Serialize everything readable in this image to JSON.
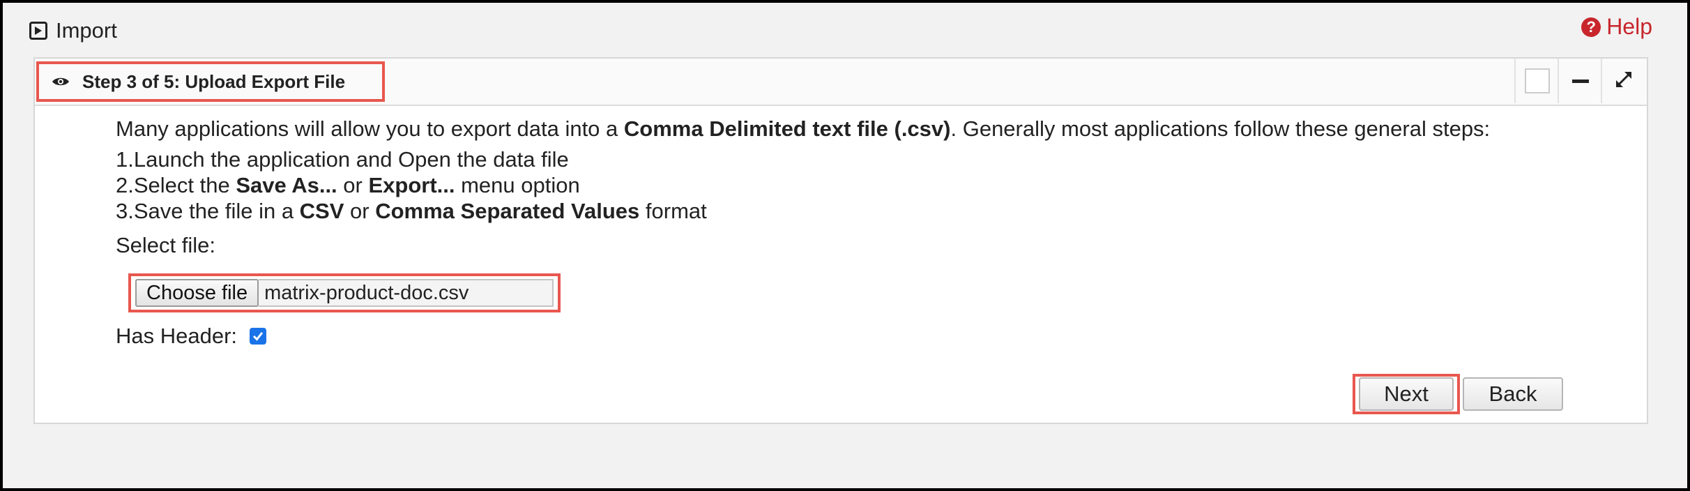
{
  "header": {
    "title": "Import",
    "help_label": "Help"
  },
  "panel": {
    "step_title": "Step 3 of 5: Upload Export File"
  },
  "instructions": {
    "intro_prefix": "Many applications will allow you to export data into a ",
    "intro_bold": "Comma Delimited text file (.csv)",
    "intro_suffix": ". Generally most applications follow these general steps:",
    "step1": "1.Launch the application and Open the data file",
    "step2_prefix": "2.Select the ",
    "step2_bold1": "Save As...",
    "step2_mid": " or ",
    "step2_bold2": "Export...",
    "step2_suffix": " menu option",
    "step3_prefix": "3.Save the file in a ",
    "step3_bold1": "CSV",
    "step3_mid": " or ",
    "step3_bold2": "Comma Separated Values",
    "step3_suffix": " format"
  },
  "file_input": {
    "label": "Select file:",
    "button_label": "Choose file",
    "file_name": "matrix-product-doc.csv"
  },
  "has_header": {
    "label": "Has Header:",
    "checked": true
  },
  "actions": {
    "next_label": "Next",
    "back_label": "Back"
  },
  "colors": {
    "highlight": "#e8574f",
    "help": "#c8262c",
    "checkbox": "#1a73e8"
  },
  "icons": {
    "title_icon": "play-square-icon",
    "help_icon": "question-circle-icon",
    "step_icon": "eye-icon",
    "header_buttons": [
      "blank-square-icon",
      "minimize-icon",
      "expand-icon"
    ]
  }
}
